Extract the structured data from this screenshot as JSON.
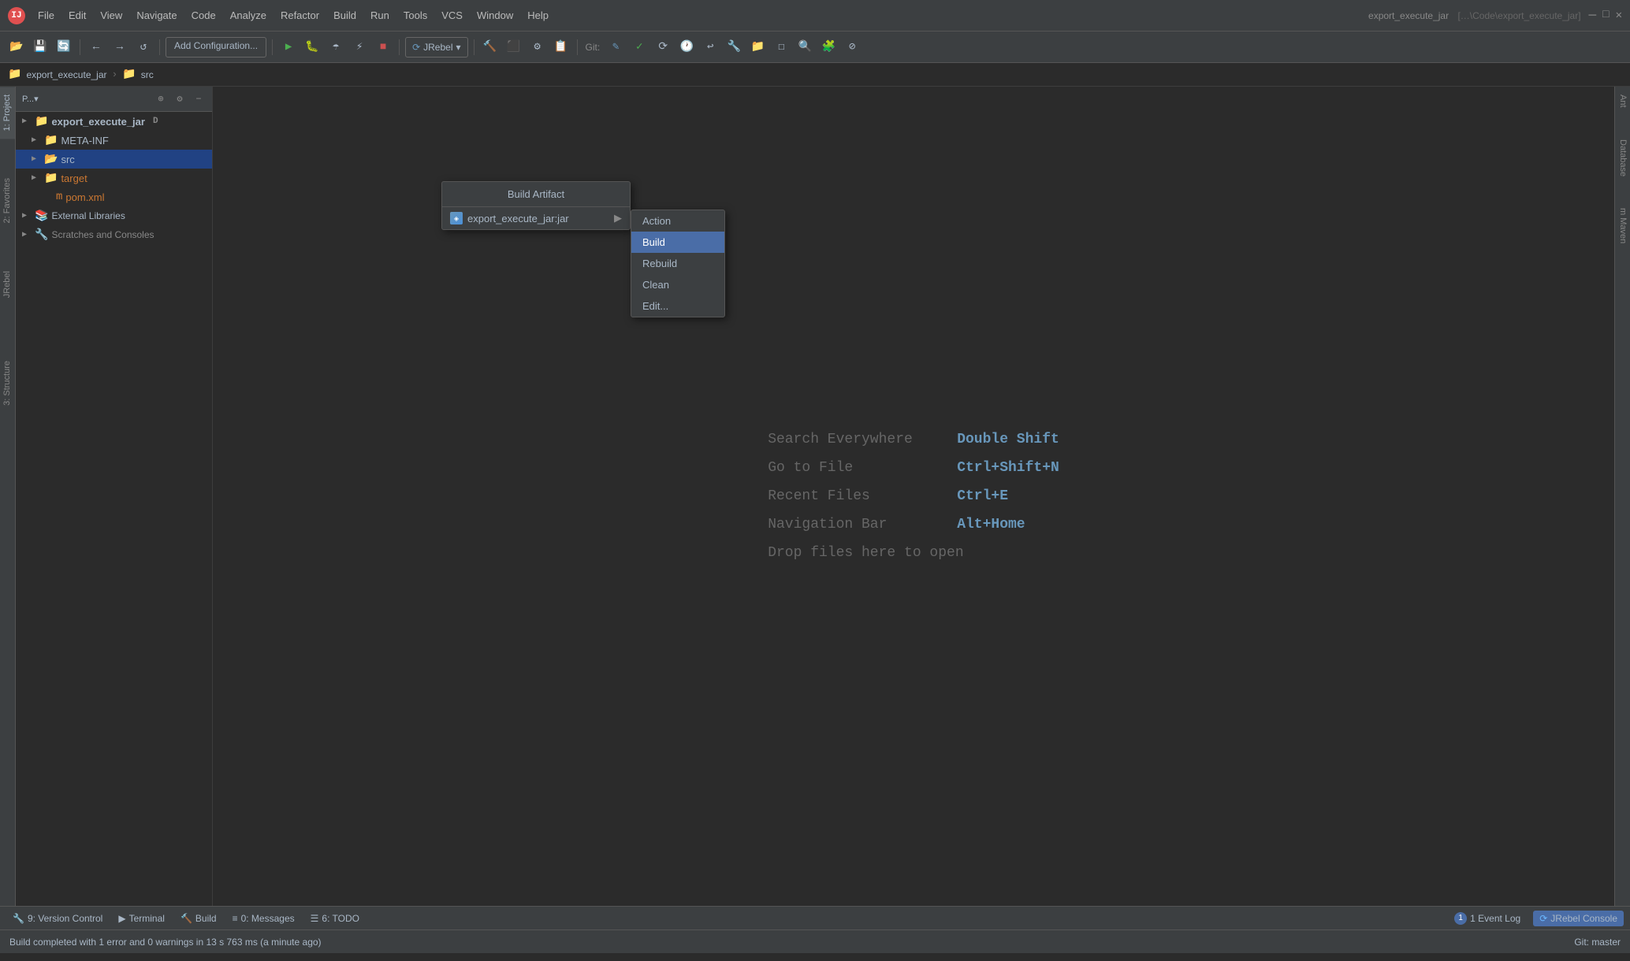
{
  "titlebar": {
    "logo": "IJ",
    "menus": [
      "File",
      "Edit",
      "View",
      "Navigate",
      "Code",
      "Analyze",
      "Refactor",
      "Build",
      "Run",
      "Tools",
      "VCS",
      "Window",
      "Help"
    ],
    "project_title": "export_execute_jar",
    "project_path": "[…\\Code\\export_execute_jar]"
  },
  "toolbar": {
    "config_label": "Add Configuration...",
    "jrebel_label": "JRebel",
    "git_label": "Git:"
  },
  "breadcrumb": {
    "project": "export_execute_jar",
    "src": "src"
  },
  "sidebar": {
    "header": "P...▾",
    "items": [
      {
        "label": "export_execute_jar",
        "type": "root",
        "indent": 0
      },
      {
        "label": "META-INF",
        "type": "folder",
        "indent": 1
      },
      {
        "label": "src",
        "type": "folder-blue",
        "indent": 1,
        "selected": true
      },
      {
        "label": "target",
        "type": "folder-orange",
        "indent": 1
      },
      {
        "label": "pom.xml",
        "type": "file-xml",
        "indent": 2
      },
      {
        "label": "External Libraries",
        "type": "lib",
        "indent": 0
      },
      {
        "label": "Scratches and Consoles",
        "type": "scratch",
        "indent": 0
      }
    ]
  },
  "welcome": {
    "search_label": "Search Everywhere",
    "search_shortcut": "Double Shift",
    "goto_label": "Go to File",
    "goto_shortcut": "Ctrl+Shift+N",
    "recent_label": "Recent Files",
    "recent_shortcut": "Ctrl+E",
    "nav_label": "Navigation Bar",
    "nav_shortcut": "Alt+Home",
    "drop_label": "Drop files here to open"
  },
  "build_artifact_menu": {
    "title": "Build Artifact",
    "artifact_name": "export_execute_jar:jar",
    "actions": [
      "Action",
      "Build",
      "Rebuild",
      "Clean",
      "Edit..."
    ]
  },
  "bottom_tabs": [
    {
      "icon": "🔧",
      "label": "9: Version Control"
    },
    {
      "icon": "▶",
      "label": "Terminal"
    },
    {
      "icon": "🔨",
      "label": "Build"
    },
    {
      "icon": "≡",
      "label": "0: Messages"
    },
    {
      "icon": "☰",
      "label": "6: TODO"
    }
  ],
  "bottom_right": {
    "event_log": "1  Event Log",
    "jrebel_console": "JRebel Console"
  },
  "statusbar": {
    "message": "Build completed with 1 error and 0 warnings in 13 s 763 ms (a minute ago)",
    "git_branch": "Git: master"
  },
  "right_tabs": [
    "Ant",
    "Database",
    "m Maven"
  ]
}
